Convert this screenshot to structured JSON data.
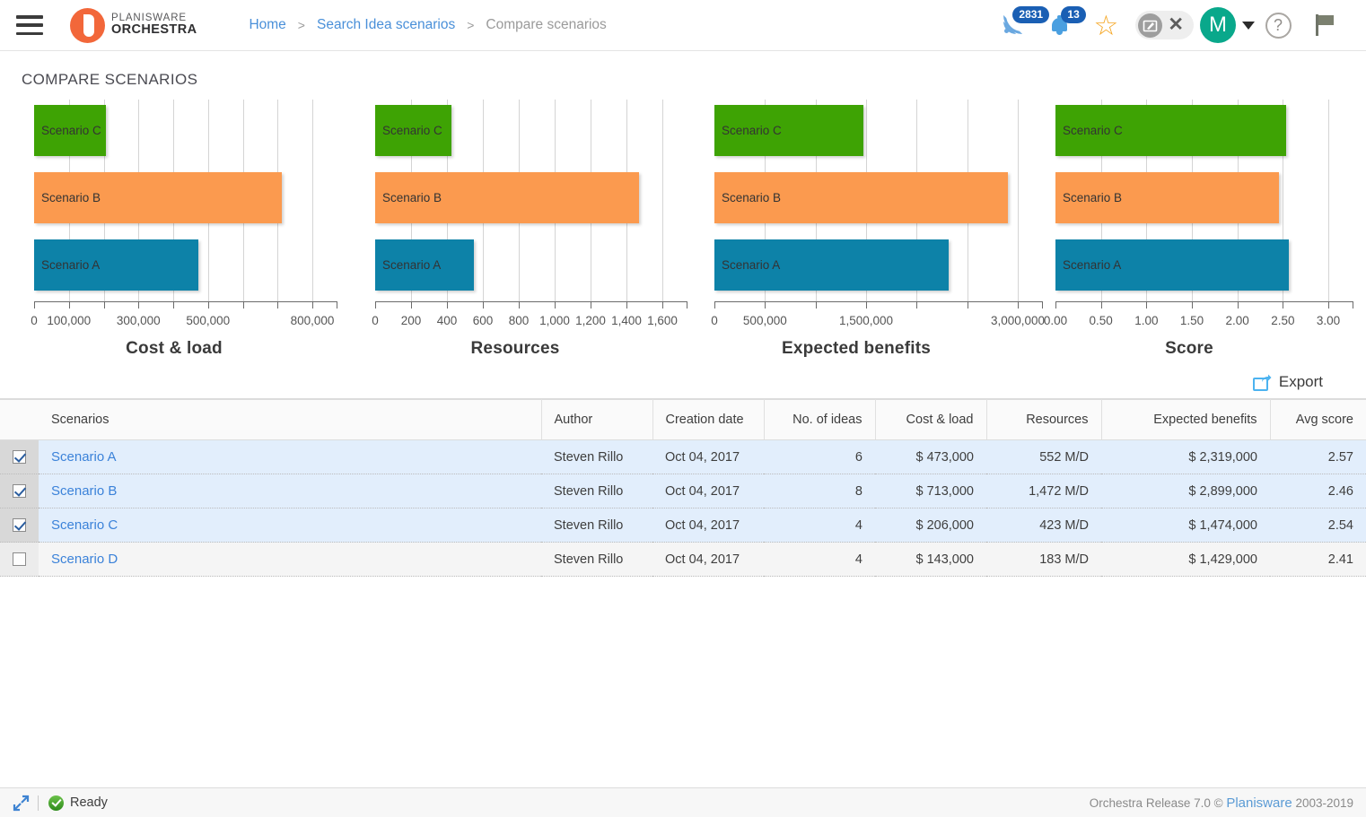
{
  "header": {
    "menu_icon": "hamburger-icon",
    "brand_line1": "PLANISWARE",
    "brand_line2": "ORCHESTRA",
    "breadcrumb": [
      {
        "label": "Home",
        "active": true
      },
      {
        "label": "Search Idea scenarios",
        "active": true
      },
      {
        "label": "Compare scenarios",
        "active": false
      }
    ],
    "separator": ">",
    "rss_badge": "2831",
    "bell_badge": "13",
    "avatar_initial": "M",
    "help_glyph": "?",
    "icons": [
      "rss-feed-icon",
      "notification-bell-icon",
      "favorite-star-icon",
      "screenshot-icon",
      "close-icon",
      "user-avatar",
      "help-icon",
      "flag-icon"
    ]
  },
  "page": {
    "title": "COMPARE SCENARIOS"
  },
  "chart_data": [
    {
      "type": "bar",
      "orientation": "horizontal",
      "title": "Cost & load",
      "categories": [
        "Scenario C",
        "Scenario B",
        "Scenario A"
      ],
      "values": [
        206000,
        713000,
        473000
      ],
      "colors": [
        "#3ea304",
        "#fb9a4f",
        "#0d82a8"
      ],
      "xlim": [
        0,
        800000
      ],
      "ticks": [
        0,
        100000,
        200000,
        300000,
        400000,
        500000,
        600000,
        700000,
        800000
      ],
      "ticklabels": [
        "0",
        "100,000",
        "",
        "300,000",
        "",
        "500,000",
        "",
        "",
        "800,000"
      ],
      "grid": true,
      "legend": "none"
    },
    {
      "type": "bar",
      "orientation": "horizontal",
      "title": "Resources",
      "categories": [
        "Scenario C",
        "Scenario B",
        "Scenario A"
      ],
      "values": [
        423,
        1472,
        552
      ],
      "colors": [
        "#3ea304",
        "#fb9a4f",
        "#0d82a8"
      ],
      "xlim": [
        0,
        1600
      ],
      "ticks": [
        0,
        200,
        400,
        600,
        800,
        1000,
        1200,
        1400,
        1600
      ],
      "ticklabels": [
        "0",
        "200",
        "400",
        "600",
        "800",
        "1,000",
        "1,200",
        "1,400",
        "1,600"
      ],
      "grid": true,
      "legend": "none"
    },
    {
      "type": "bar",
      "orientation": "horizontal",
      "title": "Expected benefits",
      "categories": [
        "Scenario C",
        "Scenario B",
        "Scenario A"
      ],
      "values": [
        1474000,
        2899000,
        2319000
      ],
      "colors": [
        "#3ea304",
        "#fb9a4f",
        "#0d82a8"
      ],
      "xlim": [
        0,
        3000000
      ],
      "ticks": [
        0,
        500000,
        1000000,
        1500000,
        2000000,
        2500000,
        3000000
      ],
      "ticklabels": [
        "0",
        "500,000",
        "",
        "1,500,000",
        "",
        "",
        "3,000,000"
      ],
      "grid": true,
      "legend": "none"
    },
    {
      "type": "bar",
      "orientation": "horizontal",
      "title": "Score",
      "categories": [
        "Scenario C",
        "Scenario B",
        "Scenario A"
      ],
      "values": [
        2.54,
        2.46,
        2.57
      ],
      "colors": [
        "#3ea304",
        "#fb9a4f",
        "#0d82a8"
      ],
      "xlim": [
        0,
        3
      ],
      "ticks": [
        0,
        0.5,
        1,
        1.5,
        2,
        2.5,
        3
      ],
      "ticklabels": [
        "0.00",
        "0.50",
        "1.00",
        "1.50",
        "2.00",
        "2.50",
        "3.00"
      ],
      "grid": true,
      "legend": "none"
    }
  ],
  "toolbar": {
    "export_label": "Export"
  },
  "table": {
    "columns": [
      "Scenarios",
      "Author",
      "Creation date",
      "No. of ideas",
      "Cost & load",
      "Resources",
      "Expected benefits",
      "Avg score"
    ],
    "rows": [
      {
        "checked": true,
        "scenario": "Scenario A",
        "author": "Steven Rillo",
        "creation_date": "Oct 04, 2017",
        "no_of_ideas": "6",
        "cost_load": "$ 473,000",
        "resources": "552 M/D",
        "expected_benefits": "$ 2,319,000",
        "avg_score": "2.57"
      },
      {
        "checked": true,
        "scenario": "Scenario B",
        "author": "Steven Rillo",
        "creation_date": "Oct 04, 2017",
        "no_of_ideas": "8",
        "cost_load": "$ 713,000",
        "resources": "1,472 M/D",
        "expected_benefits": "$ 2,899,000",
        "avg_score": "2.46"
      },
      {
        "checked": true,
        "scenario": "Scenario C",
        "author": "Steven Rillo",
        "creation_date": "Oct 04, 2017",
        "no_of_ideas": "4",
        "cost_load": "$ 206,000",
        "resources": "423 M/D",
        "expected_benefits": "$ 1,474,000",
        "avg_score": "2.54"
      },
      {
        "checked": false,
        "scenario": "Scenario D",
        "author": "Steven Rillo",
        "creation_date": "Oct 04, 2017",
        "no_of_ideas": "4",
        "cost_load": "$ 143,000",
        "resources": "183 M/D",
        "expected_benefits": "$ 1,429,000",
        "avg_score": "2.41"
      }
    ]
  },
  "footer": {
    "status": "Ready",
    "copyright_prefix": "Orchestra Release 7.0 © ",
    "copyright_brand": "Planisware",
    "copyright_suffix": " 2003-2019"
  },
  "colors": {
    "blue": "#0d82a8",
    "orange": "#fb9a4f",
    "green": "#3ea304",
    "link": "#3b82d9",
    "brand_orange": "#f2673a",
    "avatar_green": "#09a88b"
  }
}
